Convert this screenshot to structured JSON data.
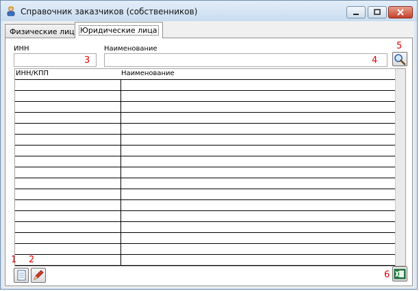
{
  "window": {
    "title": "Справочник заказчиков (собственников)",
    "icon": "user-icon",
    "controls": [
      "minimize-icon",
      "maximize-icon",
      "close-icon"
    ]
  },
  "tabs": [
    {
      "label": "Физические лица",
      "active": false
    },
    {
      "label": "Юридические лица",
      "active": true
    }
  ],
  "filters": {
    "inn_label": "ИНН",
    "inn_value": "",
    "name_label": "Наименование",
    "name_value": "",
    "search_icon": "magnifier-icon"
  },
  "table": {
    "columns": [
      "ИНН/КПП",
      "Наименование"
    ],
    "rows": []
  },
  "annotations": {
    "n1": "1",
    "n2": "2",
    "n3": "3",
    "n4": "4",
    "n5": "5",
    "n6": "6"
  },
  "toolbar": {
    "add_icon": "document-icon",
    "edit_icon": "pencil-icon",
    "export_icon": "excel-icon"
  },
  "colors": {
    "annotation": "#e00000",
    "titlebar": "#c9dcf0",
    "excel": "#1e7a3c"
  }
}
